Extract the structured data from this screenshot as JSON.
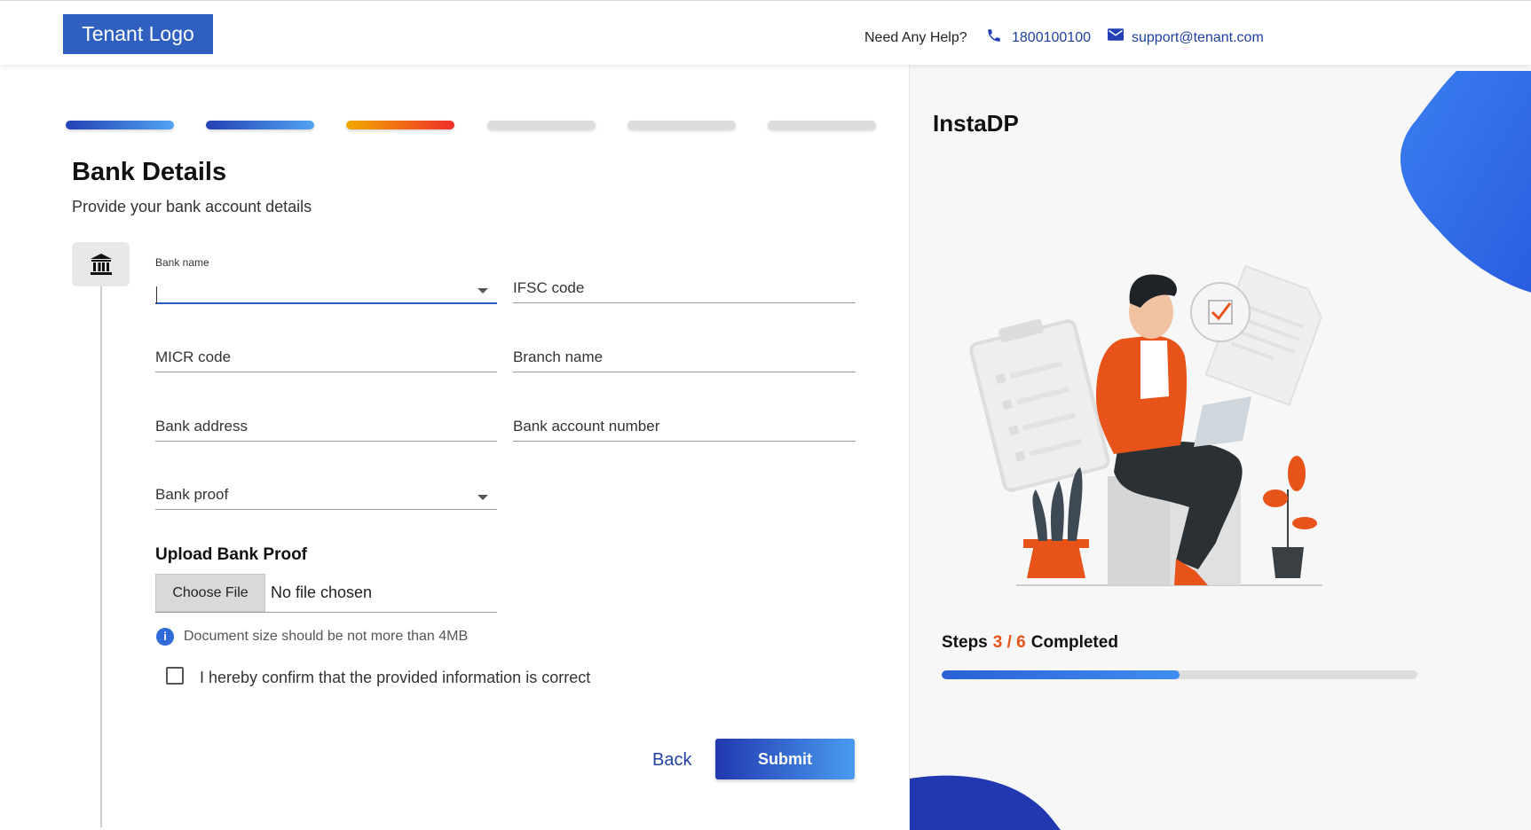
{
  "header": {
    "logo": "Tenant Logo",
    "help_text": "Need Any Help?",
    "phone": "1800100100",
    "email": "support@tenant.com",
    "icons": [
      "phone-icon",
      "mail-icon"
    ]
  },
  "stepper": {
    "total": 6,
    "current": 3,
    "colors": {
      "done": "#2341b4",
      "active": "#f0302a",
      "pending": "#dddddd"
    }
  },
  "form": {
    "title": "Bank Details",
    "subtitle": "Provide your bank account details",
    "section_icon": "bank-icon",
    "fields": {
      "bank_name": {
        "label": "Bank name",
        "value": ""
      },
      "ifsc_code": {
        "label": "IFSC code",
        "value": ""
      },
      "micr_code": {
        "label": "MICR code",
        "value": ""
      },
      "branch_name": {
        "label": "Branch name",
        "value": ""
      },
      "bank_address": {
        "label": "Bank address",
        "value": ""
      },
      "bank_account_number": {
        "label": "Bank account number",
        "value": ""
      },
      "bank_proof": {
        "label": "Bank proof",
        "value": ""
      }
    },
    "upload": {
      "title": "Upload Bank Proof",
      "button": "Choose File",
      "status": "No file chosen",
      "info": "Document size should be not more than 4MB"
    },
    "confirm_label": "I hereby confirm that the provided information is correct",
    "confirm_checked": false,
    "back_label": "Back",
    "submit_label": "Submit"
  },
  "side_panel": {
    "title": "InstaDP",
    "steps_prefix": "Steps",
    "steps_current": "3",
    "steps_separator": "/",
    "steps_total": "6",
    "steps_suffix": "Completed",
    "progress_fraction": 0.5,
    "accent": "#e8531a"
  }
}
